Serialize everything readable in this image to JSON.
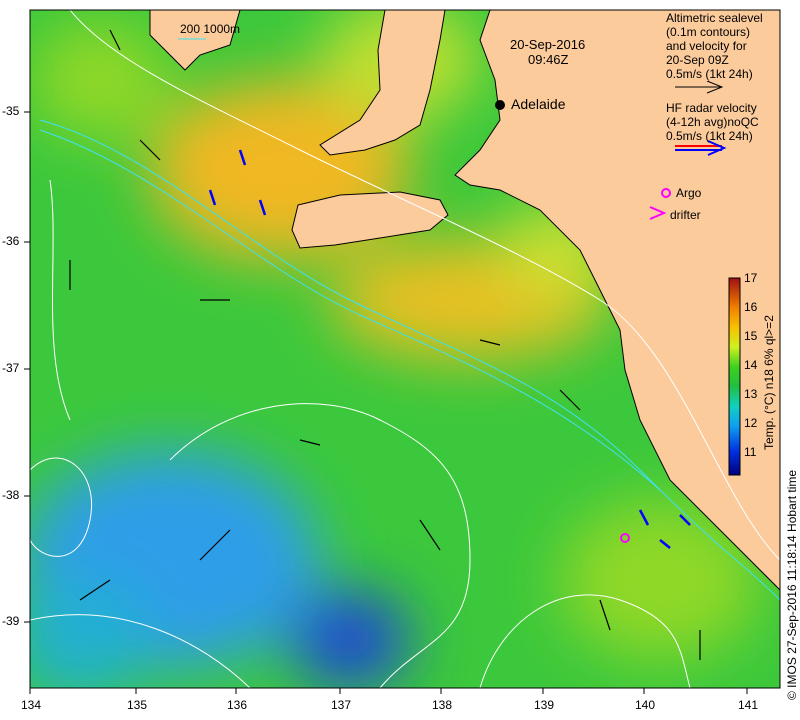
{
  "map": {
    "date": "20-Sep-2016",
    "time": "09:46Z",
    "city": "Adelaide",
    "scale_label": "200  1000m",
    "altimetry_legend": [
      "Altimetric sealevel",
      "(0.1m contours)",
      "and velocity for",
      "20-Sep 09Z",
      "0.5m/s (1kt 24h)"
    ],
    "hf_legend": [
      "HF radar velocity",
      "(4-12h avg)noQC",
      "0.5m/s (1kt 24h)"
    ],
    "argo_label": "Argo",
    "drifter_label": "drifter",
    "x_ticks": [
      "134",
      "135",
      "136",
      "137",
      "138",
      "139",
      "140",
      "141"
    ],
    "y_ticks": [
      "-35",
      "-36",
      "-37",
      "-38",
      "-39"
    ],
    "credit": "© IMOS 27-Sep-2016 11:18:14 Hobart time",
    "colors": {
      "land": "#fccb9c",
      "warm": "#f0a020",
      "mid": "#30c030",
      "cool": "#2090e0",
      "hf_red": "#ff0000",
      "hf_blue": "#0000ff",
      "argo": "#ff00ff"
    }
  },
  "colorbar": {
    "label": "Temp. (°C) n18 6% ql>=2",
    "ticks": [
      "17",
      "16",
      "15",
      "14",
      "13",
      "12",
      "11"
    ],
    "min": 10.5,
    "max": 17
  }
}
